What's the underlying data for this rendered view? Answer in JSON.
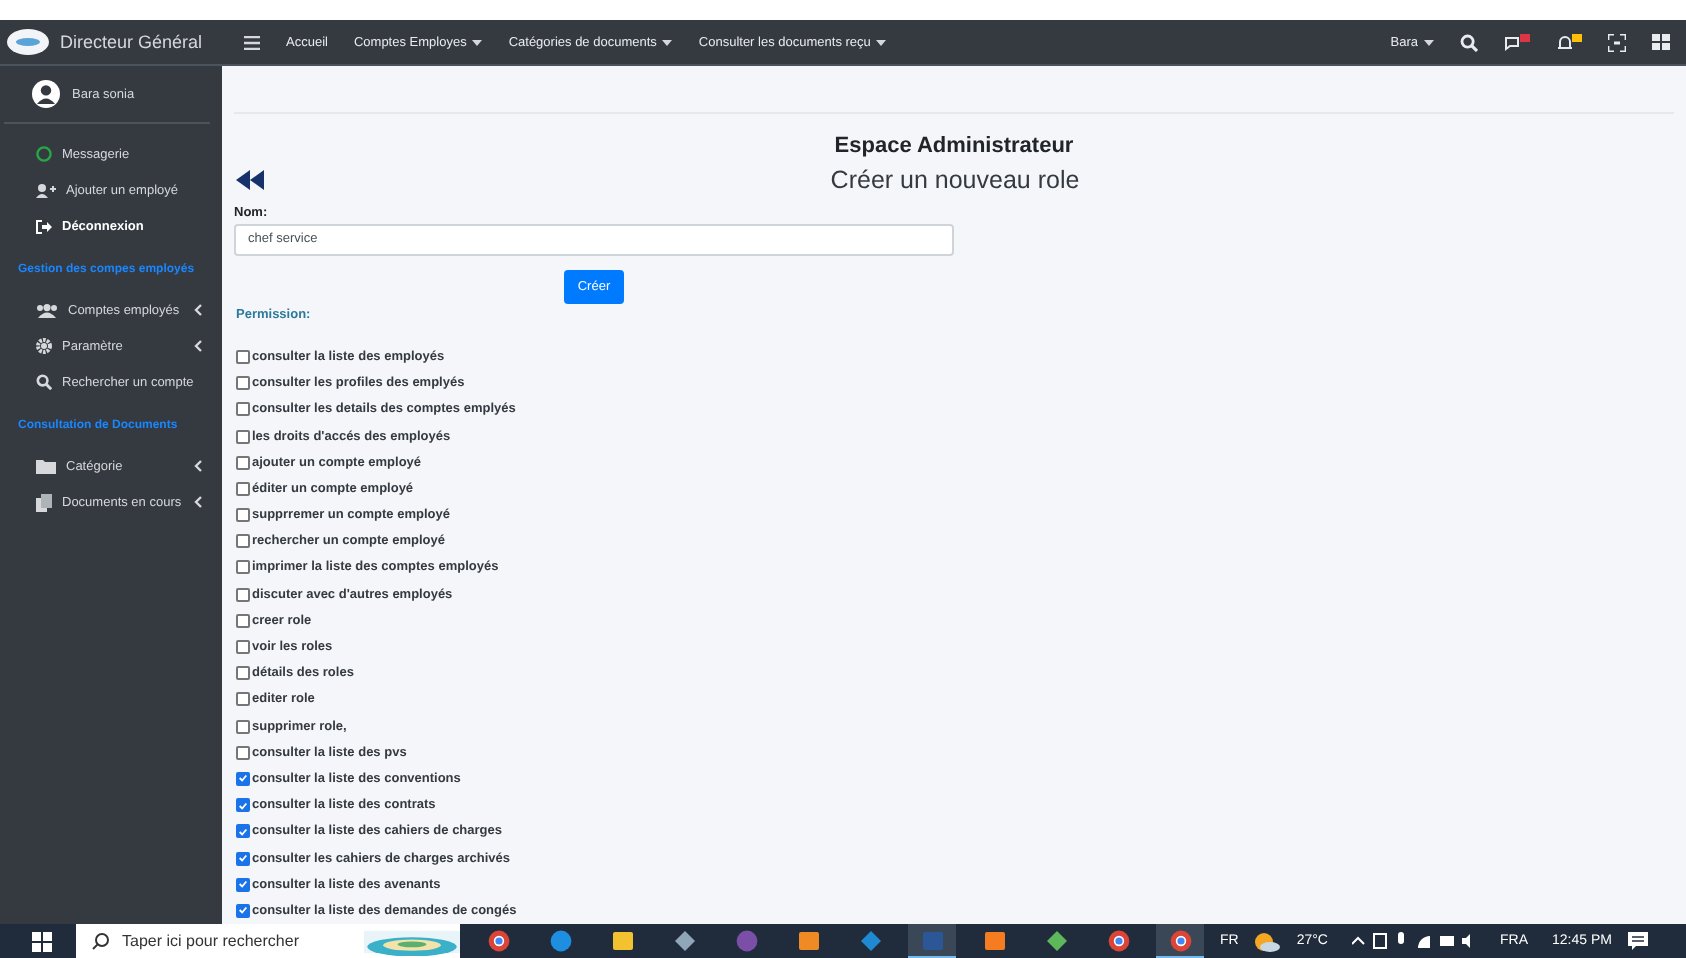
{
  "brand": {
    "title": "Directeur Général"
  },
  "navbar": {
    "items": [
      {
        "label": "Accueil",
        "dropdown": false
      },
      {
        "label": "Comptes Employes",
        "dropdown": true
      },
      {
        "label": "Catégories de documents",
        "dropdown": true
      },
      {
        "label": "Consulter les documents reçu",
        "dropdown": true
      }
    ],
    "user": "Bara",
    "icons": [
      {
        "kind": "search"
      },
      {
        "kind": "messages"
      },
      {
        "kind": "bell"
      },
      {
        "kind": "expand"
      },
      {
        "kind": "grid"
      }
    ]
  },
  "sidebar": {
    "user": "Bara sonia",
    "items": [
      {
        "kind": "circle",
        "label": "Messagerie",
        "bold": false,
        "caret": false
      },
      {
        "kind": "user-plus",
        "label": "Ajouter un employé",
        "bold": false,
        "caret": false
      },
      {
        "kind": "logout",
        "label": "Déconnexion",
        "bold": true,
        "caret": false
      },
      {
        "kind": "header",
        "label": "Gestion des compes employés"
      },
      {
        "kind": "users",
        "label": "Comptes employés",
        "bold": false,
        "caret": true
      },
      {
        "kind": "gear",
        "label": "Paramètre",
        "bold": false,
        "caret": true
      },
      {
        "kind": "search",
        "label": "Rechercher un compte",
        "bold": false,
        "caret": false
      },
      {
        "kind": "header",
        "label": "Consultation de Documents"
      },
      {
        "kind": "folder",
        "label": "Catégorie",
        "bold": false,
        "caret": true
      },
      {
        "kind": "copy",
        "label": "Documents en cours",
        "bold": false,
        "caret": true
      }
    ]
  },
  "main": {
    "title": "Espace Administrateur",
    "subtitle": "Créer un nouveau role",
    "name_label": "Nom:",
    "name_value": "chef service",
    "submit": "Créer",
    "permission_label": "Permission:",
    "permissions": [
      {
        "label": "consulter la liste des employés",
        "checked": false
      },
      {
        "label": "consulter les profiles des emplyés",
        "checked": false
      },
      {
        "label": "consulter les details des comptes emplyés",
        "checked": false
      },
      {
        "label": "les droits d'accés des employés",
        "checked": false
      },
      {
        "label": "ajouter un compte employé",
        "checked": false
      },
      {
        "label": "éditer un compte employé",
        "checked": false
      },
      {
        "label": "supprremer un compte employé",
        "checked": false
      },
      {
        "label": "rechercher un compte employé",
        "checked": false
      },
      {
        "label": "imprimer la liste des comptes employés",
        "checked": false
      },
      {
        "label": "discuter avec d'autres employés",
        "checked": false
      },
      {
        "label": "creer role",
        "checked": false
      },
      {
        "label": "voir les roles",
        "checked": false
      },
      {
        "label": "détails des roles",
        "checked": false
      },
      {
        "label": "editer role",
        "checked": false
      },
      {
        "label": "supprimer role,",
        "checked": false
      },
      {
        "label": "consulter la liste des pvs",
        "checked": false
      },
      {
        "label": "consulter la liste des conventions",
        "checked": true
      },
      {
        "label": "consulter la liste des contrats",
        "checked": true
      },
      {
        "label": "consulter la liste des cahiers de charges",
        "checked": true
      },
      {
        "label": "consulter les cahiers de charges archivés",
        "checked": true
      },
      {
        "label": "consulter la liste des avenants",
        "checked": true
      },
      {
        "label": "consulter la liste des demandes de congés",
        "checked": true
      }
    ]
  },
  "taskbar": {
    "search_placeholder": "Taper ici pour rechercher",
    "apps": [
      {
        "kind": "chrome",
        "selected": false
      },
      {
        "kind": "edge",
        "selected": false
      },
      {
        "kind": "folder",
        "selected": false
      },
      {
        "kind": "pen",
        "selected": false
      },
      {
        "kind": "orb",
        "selected": false
      },
      {
        "kind": "sublime",
        "selected": false
      },
      {
        "kind": "vscode",
        "selected": false
      },
      {
        "kind": "word",
        "selected": true
      },
      {
        "kind": "xampp",
        "selected": false
      },
      {
        "kind": "diamond",
        "selected": false
      },
      {
        "kind": "chrome",
        "selected": false
      },
      {
        "kind": "chrome",
        "selected": true
      }
    ],
    "lang": "FR",
    "temperature": "27°C",
    "keyboard": "FRA",
    "time": "12:45 PM"
  }
}
